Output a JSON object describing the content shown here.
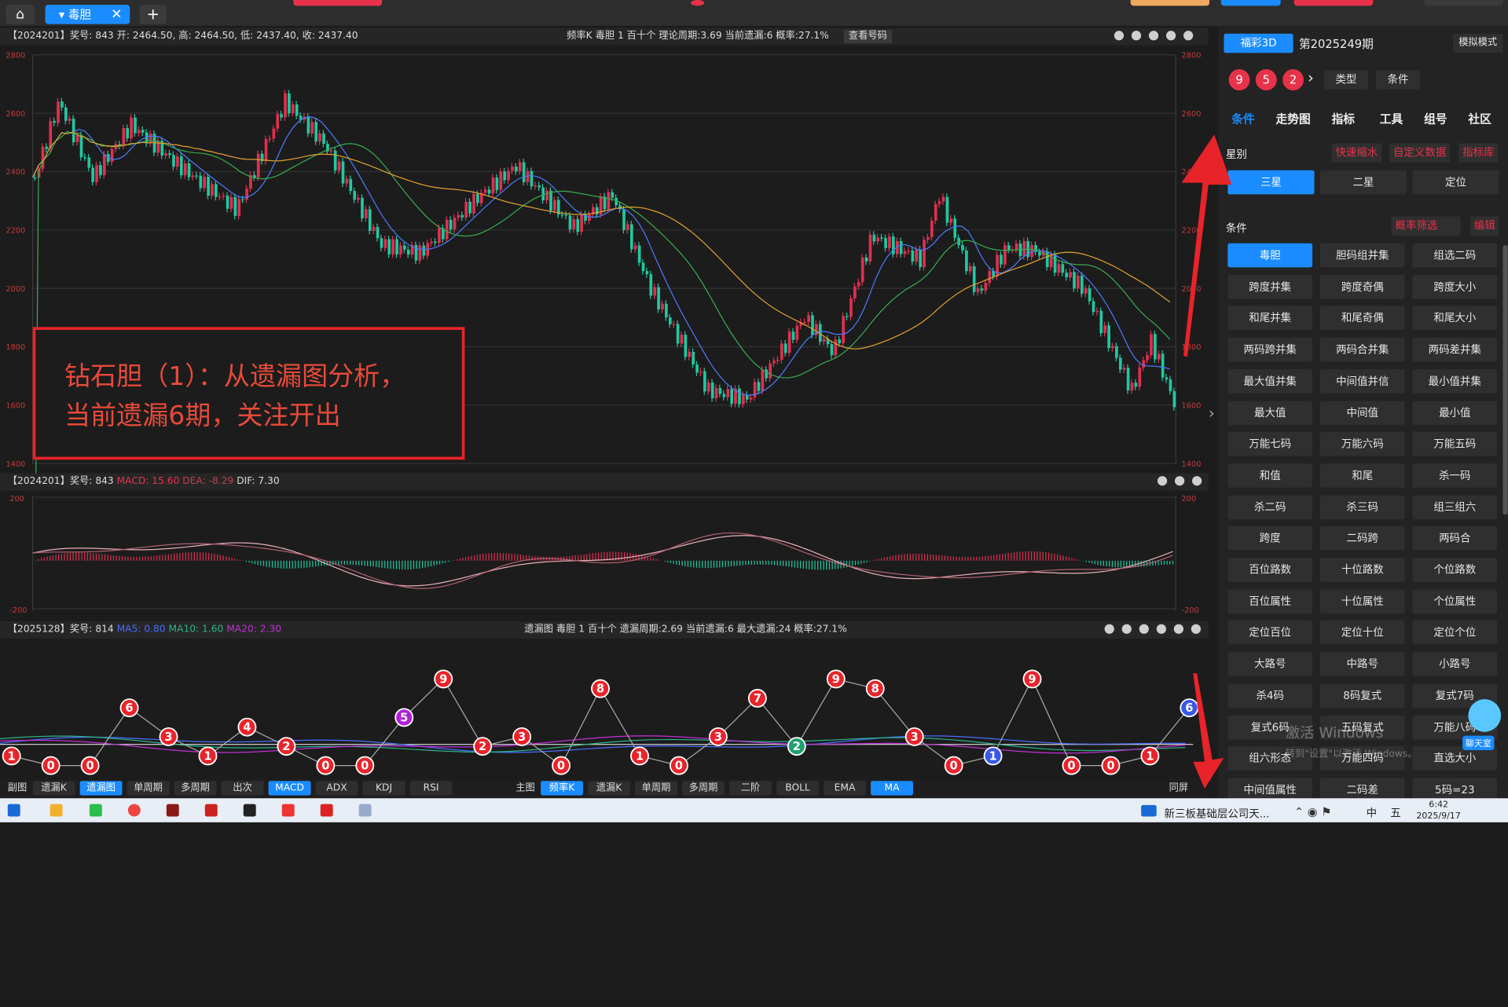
{
  "tabs": {
    "home_icon": "home-icon",
    "active_tab": "毒胆",
    "close": "✕",
    "add": "+"
  },
  "kline_panel": {
    "info": "【2024201】奖号: 843  开: 2464.50, 高: 2464.50, 低: 2437.40, 收: 2437.40",
    "stats": "频率K   毒胆   1   百十个   理论周期:3.69   当前遗漏:6   概率:27.1%",
    "view_btn": "查看号码",
    "y_ticks": [
      "2800",
      "2600",
      "2400",
      "2200",
      "2000",
      "1800",
      "1600",
      "1400"
    ],
    "annotation_line1": "钻石胆（1）：从遗漏图分析，",
    "annotation_line2": "当前遗漏6期，关注开出"
  },
  "macd_panel": {
    "info_prefix": "【2024201】奖号: 843 ",
    "macd": "MACD: 15.60",
    "dea": "DEA: -8.29",
    "dif": "DIF: 7.30",
    "y_ticks": [
      "200",
      "-200"
    ]
  },
  "omit_panel": {
    "info_prefix": "【2025128】奖号: 814 ",
    "ma5": "MA5: 0.80",
    "ma10": "MA10: 1.60",
    "ma20": "MA20: 2.30",
    "stats": "遗漏图   毒胆   1   百十个   遗漏周期:2.69   当前遗漏:6   最大遗漏:24   概率:27.1%",
    "points": [
      1,
      0,
      0,
      6,
      3,
      1,
      4,
      2,
      0,
      0,
      5,
      9,
      2,
      3,
      0,
      8,
      1,
      0,
      3,
      7,
      2,
      9,
      8,
      3,
      0,
      1,
      9,
      0,
      0,
      1,
      6
    ]
  },
  "subchart_tabs": {
    "label": "副图",
    "items": [
      "遗漏K",
      "遗漏图",
      "单周期",
      "多周期",
      "出次",
      "MACD",
      "ADX",
      "KDJ",
      "RSI"
    ]
  },
  "mainchart_tabs": {
    "label": "主图",
    "items": [
      "频率K",
      "遗漏K",
      "单周期",
      "多周期",
      "二阶",
      "BOLL",
      "EMA",
      "MA"
    ],
    "fullscreen": "同屏"
  },
  "right": {
    "lottery": "福彩3D",
    "period": "第2025249期",
    "mode": "模拟模式",
    "balls": [
      "9",
      "5",
      "2"
    ],
    "type_select": "类型",
    "cond_select": "条件",
    "nav": [
      "条件",
      "走势图",
      "指标",
      "工具",
      "组号",
      "社区"
    ],
    "star_label": "星别",
    "quick": "快速缩水",
    "custom": "自定义数据",
    "indicator_lib": "指标库",
    "stars": [
      "三星",
      "二星",
      "定位"
    ],
    "cond_label": "条件",
    "prob_filter": "概率筛选",
    "edit": "编辑",
    "grid": [
      "毒胆",
      "胆码组并集",
      "组选二码",
      "跨度并集",
      "跨度奇偶",
      "跨度大小",
      "和尾并集",
      "和尾奇偶",
      "和尾大小",
      "两码跨并集",
      "两码合并集",
      "两码差并集",
      "最大值并集",
      "中间值并信",
      "最小值并集",
      "最大值",
      "中间值",
      "最小值",
      "万能七码",
      "万能六码",
      "万能五码",
      "和值",
      "和尾",
      "杀一码",
      "杀二码",
      "杀三码",
      "组三组六",
      "跨度",
      "二码跨",
      "两码合",
      "百位路数",
      "十位路数",
      "个位路数",
      "百位属性",
      "十位属性",
      "个位属性",
      "定位百位",
      "定位十位",
      "定位个位",
      "大路号",
      "中路号",
      "小路号",
      "杀4码",
      "8码复式",
      "复式7码",
      "复式6码",
      "五码复式",
      "万能八码",
      "组六形态",
      "万能四码",
      "直选大小",
      "中间值属性",
      "二码差",
      "5码=23"
    ],
    "chat": "聊天室",
    "watermark1": "激活 Windows",
    "watermark2": "转到\"设置\"以激活 Windows。"
  },
  "taskbar": {
    "news": "新三板基础层公司天...",
    "time": "6:42",
    "date": "2025/9/17",
    "ime": "中",
    "ime2": "五"
  }
}
